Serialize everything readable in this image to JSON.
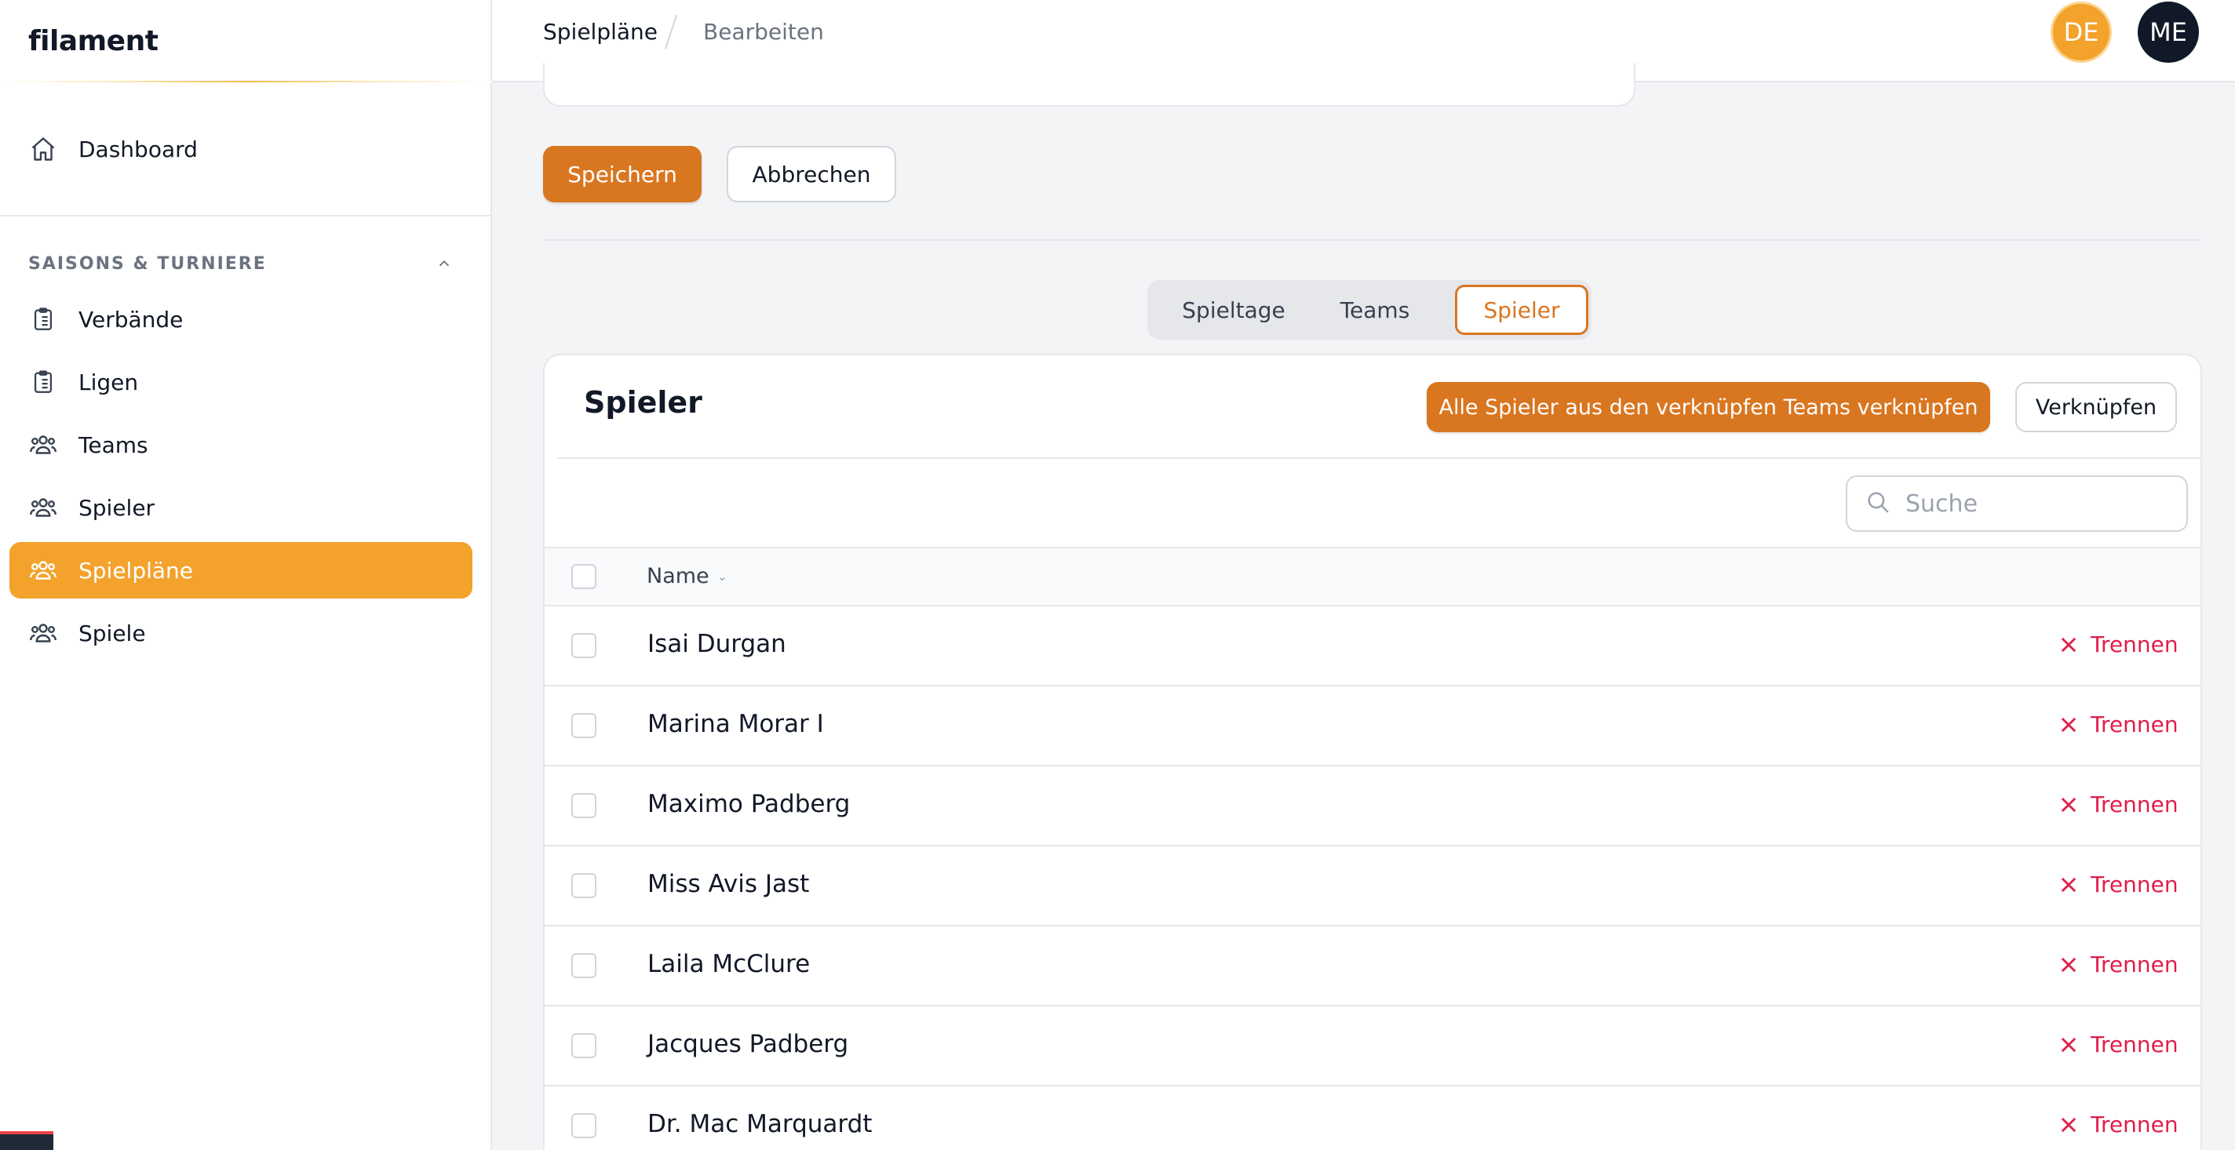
{
  "brand": {
    "name": "filament"
  },
  "sidebar": {
    "dashboard": {
      "label": "Dashboard",
      "icon": "home-icon"
    },
    "group": {
      "label": "SAISONS & TURNIERE",
      "toggle_icon": "chevron-up-icon"
    },
    "items": [
      {
        "label": "Verbände",
        "icon": "clipboard-list-icon"
      },
      {
        "label": "Ligen",
        "icon": "clipboard-list-icon"
      },
      {
        "label": "Teams",
        "icon": "user-group-icon"
      },
      {
        "label": "Spieler",
        "icon": "user-group-icon"
      },
      {
        "label": "Spielpläne",
        "icon": "user-group-icon",
        "active": true
      },
      {
        "label": "Spiele",
        "icon": "user-group-icon"
      }
    ],
    "active_color": "#f3a22c"
  },
  "topbar": {
    "breadcrumbs": [
      "Spielpläne",
      "Bearbeiten"
    ],
    "avatars": [
      {
        "initials": "DE",
        "color": "#f3a22c"
      },
      {
        "initials": "ME",
        "color": "#111827"
      }
    ]
  },
  "form_actions": {
    "save": "Speichern",
    "cancel": "Abbrechen"
  },
  "tabs": [
    {
      "label": "Spieltage",
      "active": false
    },
    {
      "label": "Teams",
      "active": false
    },
    {
      "label": "Spieler",
      "active": true
    }
  ],
  "relation": {
    "title": "Spieler",
    "attach_all_button": "Alle Spieler aus den verknüpfen Teams verknüpfen",
    "attach_button": "Verknüpfen",
    "search_placeholder": "Suche",
    "columns": {
      "name": "Name"
    },
    "row_action_label": "Trennen",
    "rows": [
      "Isai Durgan",
      "Marina Morar I",
      "Maximo Padberg",
      "Miss Avis Jast",
      "Laila McClure",
      "Jacques Padberg",
      "Dr. Mac Marquardt"
    ]
  },
  "colors": {
    "primary": "#d97620",
    "danger": "#e11d48"
  }
}
